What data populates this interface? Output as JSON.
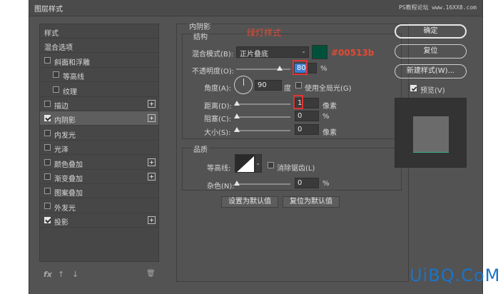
{
  "dialog": {
    "title": "图层样式",
    "watermark": "PS教程论坛 www.16XX8.com"
  },
  "styles_list": [
    {
      "label": "样式",
      "checkbox": null,
      "checked": false,
      "plus": false,
      "indent": 0,
      "selected": false
    },
    {
      "label": "混合选项",
      "checkbox": null,
      "checked": false,
      "plus": false,
      "indent": 0,
      "selected": false
    },
    {
      "label": "斜面和浮雕",
      "checkbox": true,
      "checked": false,
      "plus": false,
      "indent": 0,
      "selected": false
    },
    {
      "label": "等高线",
      "checkbox": true,
      "checked": false,
      "plus": false,
      "indent": 1,
      "selected": false
    },
    {
      "label": "纹理",
      "checkbox": true,
      "checked": false,
      "plus": false,
      "indent": 1,
      "selected": false
    },
    {
      "label": "描边",
      "checkbox": true,
      "checked": false,
      "plus": true,
      "indent": 0,
      "selected": false
    },
    {
      "label": "内阴影",
      "checkbox": true,
      "checked": true,
      "plus": true,
      "indent": 0,
      "selected": true
    },
    {
      "label": "内发光",
      "checkbox": true,
      "checked": false,
      "plus": false,
      "indent": 0,
      "selected": false
    },
    {
      "label": "光泽",
      "checkbox": true,
      "checked": false,
      "plus": false,
      "indent": 0,
      "selected": false
    },
    {
      "label": "颜色叠加",
      "checkbox": true,
      "checked": false,
      "plus": true,
      "indent": 0,
      "selected": false
    },
    {
      "label": "渐变叠加",
      "checkbox": true,
      "checked": false,
      "plus": true,
      "indent": 0,
      "selected": false
    },
    {
      "label": "图案叠加",
      "checkbox": true,
      "checked": false,
      "plus": false,
      "indent": 0,
      "selected": false
    },
    {
      "label": "外发光",
      "checkbox": true,
      "checked": false,
      "plus": false,
      "indent": 0,
      "selected": false
    },
    {
      "label": "投影",
      "checkbox": true,
      "checked": true,
      "plus": true,
      "indent": 0,
      "selected": false
    }
  ],
  "list_footer": {
    "fx_icon": "fx",
    "up_icon": "↑",
    "down_icon": "↓",
    "trash_icon": "🗑"
  },
  "inner_shadow": {
    "section_title": "内阴影",
    "structure_title": "结构",
    "annotation_label": "绿灯样式",
    "color_annotation": "#00513b",
    "color_hex": "#00513b",
    "blend_mode_label": "混合模式(B):",
    "blend_mode_value": "正片叠底",
    "opacity_label": "不透明度(O):",
    "opacity_value": "80",
    "opacity_level": 80,
    "percent": "%",
    "angle_label": "角度(A):",
    "angle_value": "90",
    "degree_unit": "度",
    "global_light_label": "使用全局光(G)",
    "distance_label": "距离(D):",
    "distance_value": "1",
    "distance_unit": "像素",
    "choke_label": "阻塞(C):",
    "choke_value": "0",
    "size_label": "大小(S):",
    "size_value": "0",
    "size_unit": "像素",
    "quality_title": "品质",
    "contour_label": "等高线:",
    "antialias_label": "消除锯齿(L)",
    "noise_label": "杂色(N):",
    "noise_value": "0",
    "set_default_button": "设置为默认值",
    "reset_default_button": "复位为默认值"
  },
  "right_panel": {
    "ok_button": "确定",
    "reset_button": "复位",
    "new_style_button": "新建样式(W)...",
    "preview_label": "预览(V)",
    "preview_checked": true
  },
  "brand_watermark": "UiBQ.CoM",
  "colors": {
    "dialog_bg": "#535353",
    "accent_green": "#00513b",
    "red_annotation": "#e34a33",
    "highlight_blue": "#3b7fd4"
  }
}
